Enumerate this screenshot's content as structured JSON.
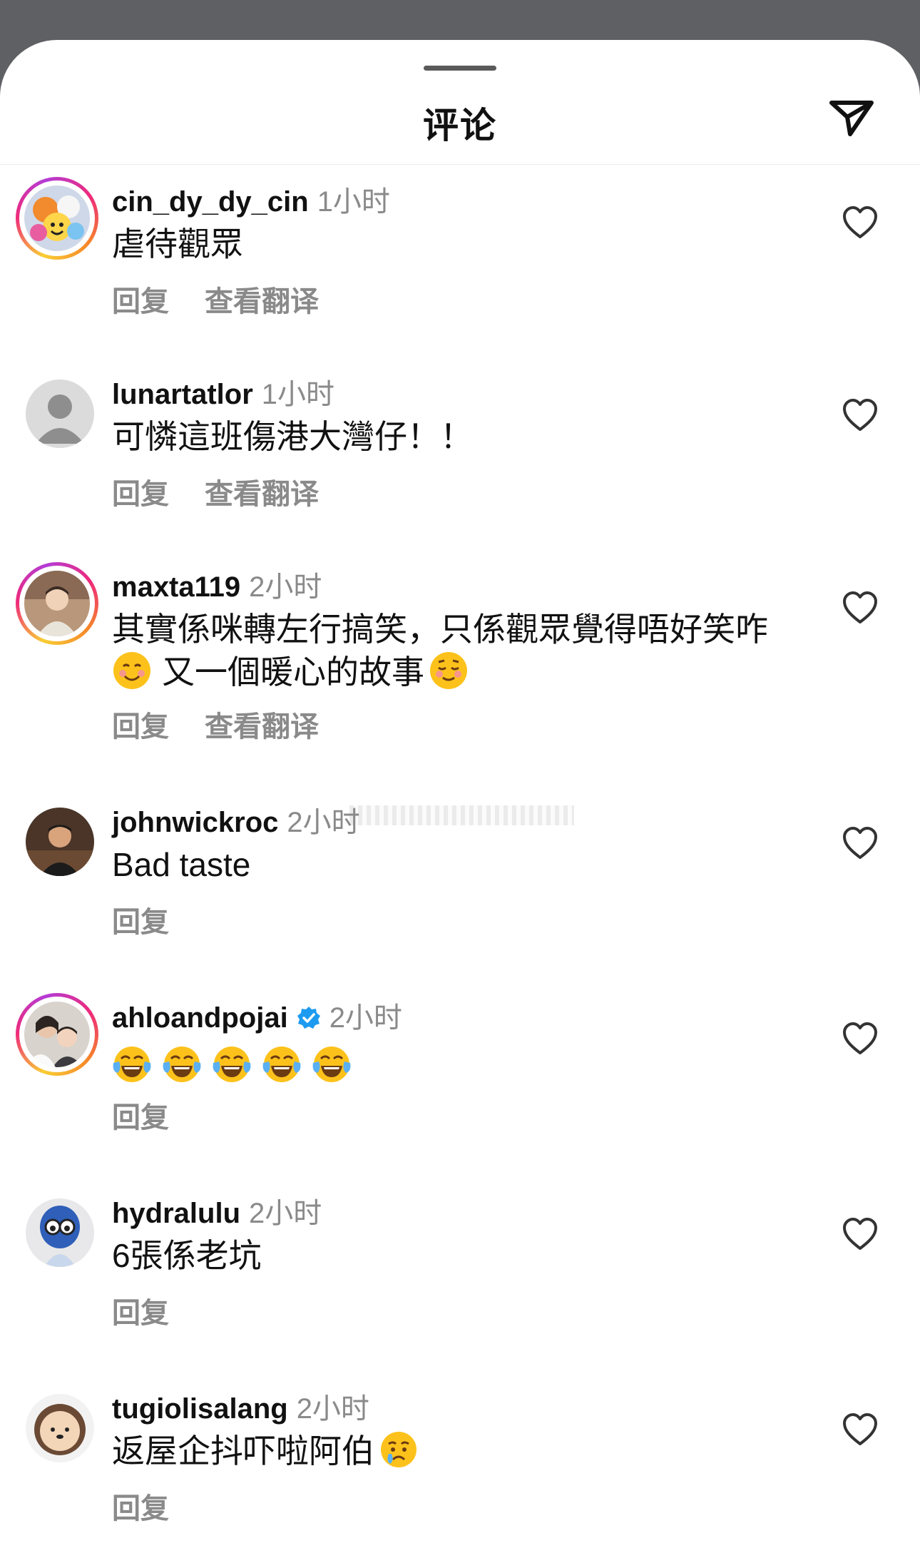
{
  "header": {
    "title": "评论"
  },
  "labels": {
    "reply": "回复",
    "translate": "查看翻译"
  },
  "comments": [
    {
      "username": "cin_dy_dy_cin",
      "time": "1小时",
      "text": "虐待觀眾"
    },
    {
      "username": "lunartatlor",
      "time": "1小时",
      "text": "可憐這班傷港大灣仔！！"
    },
    {
      "username": "maxta119",
      "time": "2小时",
      "text_line1": "其實係咪轉左行搞笑，只係觀眾覺得唔好笑咋",
      "text_line2": "又一個暖心的故事"
    },
    {
      "username": "johnwickroc",
      "time": "2小时",
      "text": "Bad taste"
    },
    {
      "username": "ahloandpojai",
      "time": "2小时",
      "verified": true
    },
    {
      "username": "hydralulu",
      "time": "2小时",
      "text": "6張係老坑"
    },
    {
      "username": "tugiolisalang",
      "time": "2小时",
      "text": "返屋企抖吓啦阿伯"
    }
  ]
}
